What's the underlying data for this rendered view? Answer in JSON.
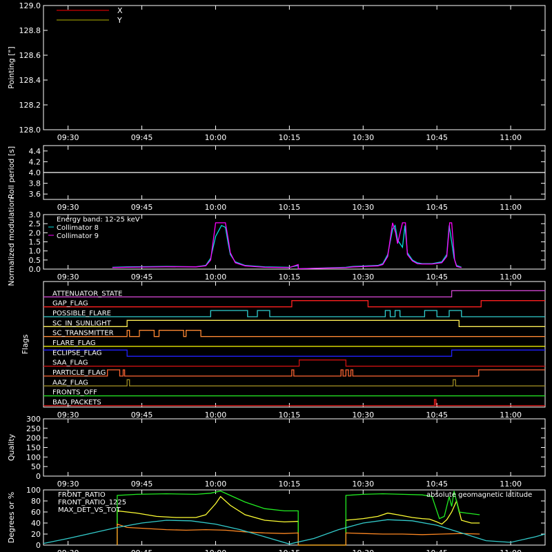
{
  "time_ticks": [
    "09:30",
    "09:45",
    "10:00",
    "10:15",
    "10:30",
    "10:45",
    "11:00"
  ],
  "time_ticks_min": [
    0,
    15,
    30,
    45,
    60,
    75,
    90
  ],
  "time_range_min": [
    -5,
    97
  ],
  "chart_data": [
    {
      "id": "pointing",
      "type": "line",
      "ylabel": "Pointing [\"]",
      "ylim": [
        128.0,
        129.0
      ],
      "yticks": [
        "128.0",
        "128.2",
        "128.4",
        "128.6",
        "128.8",
        "129.0"
      ],
      "legend": [
        {
          "name": "X",
          "color": "#ff0000"
        },
        {
          "name": "Y",
          "color": "#b3b300"
        }
      ],
      "series": []
    },
    {
      "id": "roll",
      "type": "line",
      "ylabel": "Roll period [s]",
      "ylim": [
        3.5,
        4.5
      ],
      "yticks": [
        "3.6",
        "3.8",
        "4.0",
        "4.2",
        "4.4"
      ],
      "series": [
        {
          "color": "#ffffff",
          "x": [
            -5,
            97
          ],
          "y": [
            4.0,
            4.0
          ]
        }
      ]
    },
    {
      "id": "modulation",
      "type": "line",
      "ylabel": "Normalized modulation",
      "ylim": [
        0,
        3.0
      ],
      "yticks": [
        "0.0",
        "0.5",
        "1.0",
        "1.5",
        "2.0",
        "2.5",
        "3.0"
      ],
      "legend_title": "Energy band: 12-25 keV",
      "series": [
        {
          "name": "Collimator 8",
          "color": "#00e0e0",
          "x": [
            9,
            12,
            20,
            26,
            28,
            29,
            30,
            31.2,
            32,
            32.5,
            33,
            34,
            36,
            40,
            45,
            46.8,
            46.8,
            56.5,
            58,
            63,
            64,
            65,
            66,
            66.5,
            67,
            68,
            68.5,
            69,
            70,
            71,
            72,
            74,
            76,
            77,
            77.5,
            78,
            78.5,
            79,
            80
          ],
          "y": [
            0.1,
            0.12,
            0.15,
            0.13,
            0.2,
            0.6,
            1.8,
            2.4,
            2.3,
            1.5,
            0.8,
            0.4,
            0.2,
            0.12,
            0.1,
            0.2,
            0.02,
            0.1,
            0.15,
            0.2,
            0.3,
            0.8,
            2.2,
            2.4,
            1.6,
            1.2,
            2.4,
            0.9,
            0.5,
            0.35,
            0.3,
            0.3,
            0.4,
            0.8,
            2.4,
            1.5,
            0.6,
            0.2,
            0.1
          ]
        },
        {
          "name": "Collimator 9",
          "color": "#ff00ff",
          "x": [
            9,
            12,
            20,
            26,
            28,
            29,
            30,
            31,
            32,
            32.6,
            33,
            34,
            36,
            40,
            45,
            46.8,
            46.8,
            56.5,
            58,
            63,
            64,
            65,
            66,
            66.6,
            67,
            68,
            68.6,
            69,
            70,
            71,
            72,
            74,
            76,
            77,
            77.6,
            78,
            78.6,
            79,
            80
          ],
          "y": [
            0.08,
            0.1,
            0.13,
            0.12,
            0.18,
            0.5,
            2.55,
            2.55,
            2.55,
            1.6,
            0.9,
            0.35,
            0.18,
            0.1,
            0.08,
            0.25,
            0.02,
            0.08,
            0.12,
            0.18,
            0.25,
            0.7,
            2.55,
            2.0,
            1.4,
            2.55,
            2.55,
            0.8,
            0.45,
            0.3,
            0.28,
            0.28,
            0.35,
            0.7,
            2.55,
            2.55,
            0.5,
            0.15,
            0.08
          ]
        }
      ]
    },
    {
      "id": "flags",
      "type": "line",
      "ylabel": "Flags",
      "flags": [
        {
          "name": "ATTENUATOR_STATE",
          "color": "#cc44cc",
          "steps": [
            [
              -5,
              0
            ],
            [
              78,
              1
            ],
            [
              97,
              1
            ]
          ]
        },
        {
          "name": "GAP_FLAG",
          "color": "#ff2020",
          "steps": [
            [
              -5,
              0
            ],
            [
              45.5,
              1
            ],
            [
              61,
              0
            ],
            [
              84,
              1
            ],
            [
              97,
              1
            ]
          ]
        },
        {
          "name": "POSSIBLE_FLARE",
          "color": "#30d0d0",
          "steps": [
            [
              -5,
              0
            ],
            [
              29,
              1
            ],
            [
              36.5,
              0
            ],
            [
              38.5,
              1
            ],
            [
              41,
              0
            ],
            [
              64.5,
              1
            ],
            [
              65.5,
              0
            ],
            [
              66.5,
              1
            ],
            [
              67.5,
              0
            ],
            [
              72.5,
              1
            ],
            [
              75,
              0
            ],
            [
              77.5,
              1
            ],
            [
              80,
              0
            ],
            [
              97,
              0
            ]
          ]
        },
        {
          "name": "SC_IN_SUNLIGHT",
          "color": "#ffee55",
          "steps": [
            [
              -5,
              0
            ],
            [
              12,
              1
            ],
            [
              77.5,
              1
            ],
            [
              79.5,
              0
            ],
            [
              97,
              0
            ]
          ]
        },
        {
          "name": "SC_TRANSMITTER",
          "color": "#ff8833",
          "steps": [
            [
              -5,
              0
            ],
            [
              12,
              1
            ],
            [
              12.5,
              0
            ],
            [
              14.5,
              1
            ],
            [
              17.5,
              0
            ],
            [
              18.5,
              1
            ],
            [
              23.5,
              0
            ],
            [
              24,
              1
            ],
            [
              27,
              0
            ],
            [
              97,
              0
            ]
          ]
        },
        {
          "name": "FLARE_FLAG",
          "color": "#ffff00",
          "steps": [
            [
              -5,
              0
            ],
            [
              97,
              0
            ]
          ]
        },
        {
          "name": "ECLIPSE_FLAG",
          "color": "#2020ff",
          "steps": [
            [
              -5,
              1
            ],
            [
              12,
              0
            ],
            [
              78,
              0
            ],
            [
              78,
              1
            ],
            [
              97,
              1
            ]
          ]
        },
        {
          "name": "SAA_FLAG",
          "color": "#cc1111",
          "steps": [
            [
              -5,
              0
            ],
            [
              47,
              1
            ],
            [
              56.5,
              0
            ],
            [
              97,
              0
            ]
          ]
        },
        {
          "name": "PARTICLE_FLAG",
          "color": "#ff6633",
          "steps": [
            [
              -5,
              0
            ],
            [
              8,
              1
            ],
            [
              10.5,
              0
            ],
            [
              11.2,
              1
            ],
            [
              11.5,
              0
            ],
            [
              45.5,
              1
            ],
            [
              45.9,
              0
            ],
            [
              55.5,
              1
            ],
            [
              55.9,
              0
            ],
            [
              56.5,
              1
            ],
            [
              57,
              0
            ],
            [
              57.5,
              1
            ],
            [
              57.9,
              0
            ],
            [
              83.5,
              1
            ],
            [
              97,
              1
            ]
          ]
        },
        {
          "name": "AAZ_FLAG",
          "color": "#998822",
          "steps": [
            [
              -5,
              0
            ],
            [
              12,
              1
            ],
            [
              12.5,
              0
            ],
            [
              78.3,
              1
            ],
            [
              78.8,
              0
            ],
            [
              97,
              0
            ]
          ]
        },
        {
          "name": "FRONTS_OFF",
          "color": "#22dd22",
          "steps": [
            [
              -5,
              0
            ],
            [
              97,
              0
            ]
          ]
        },
        {
          "name": "BAD_PACKETS",
          "color": "#ff2020",
          "steps": [
            [
              -5,
              0
            ],
            [
              74.5,
              1
            ],
            [
              74.8,
              0
            ],
            [
              97,
              0
            ]
          ]
        }
      ]
    },
    {
      "id": "quality",
      "type": "line",
      "ylabel": "Quality",
      "ylim": [
        0,
        300
      ],
      "yticks": [
        "0",
        "50",
        "100",
        "150",
        "200",
        "250",
        "300"
      ],
      "series": []
    },
    {
      "id": "ratios",
      "type": "line",
      "ylabel": "Degrees or %",
      "ylim": [
        0,
        100
      ],
      "yticks": [
        "0",
        "20",
        "40",
        "60",
        "80",
        "100"
      ],
      "legend": [
        {
          "name": "FRONT_RATIO",
          "color": "#ffff33"
        },
        {
          "name": "FRONT_RATIO_1225",
          "color": "#22ee22"
        },
        {
          "name": "MAX_DET_VS_TOT",
          "color": "#ff8822"
        }
      ],
      "legend_right": {
        "name": "absolute geomagnetic latitude",
        "color": "#33cccc"
      },
      "series": [
        {
          "name": "FRONT_RATIO",
          "color": "#ffff33",
          "x": [
            10,
            10,
            14,
            18,
            22,
            26,
            28,
            30,
            31,
            33,
            36,
            40,
            44,
            46.8,
            46.8,
            56.5,
            56.5,
            60,
            63,
            65,
            67,
            70,
            72,
            73.5,
            75,
            76,
            77,
            78,
            79,
            80,
            82,
            83.7
          ],
          "y": [
            0,
            62,
            58,
            52,
            50,
            50,
            55,
            75,
            88,
            72,
            55,
            45,
            42,
            43,
            0,
            0,
            45,
            48,
            52,
            58,
            55,
            50,
            48,
            47,
            42,
            38,
            46,
            60,
            80,
            45,
            40,
            40
          ]
        },
        {
          "name": "FRONT_RATIO_1225",
          "color": "#22ee22",
          "x": [
            10,
            10,
            14,
            20,
            26,
            29,
            31,
            33,
            36,
            40,
            44,
            46.8,
            46.8,
            56.5,
            56.5,
            60,
            64,
            68,
            72,
            74,
            75.5,
            76.5,
            77.5,
            78,
            78.5,
            79.5,
            81,
            83.7
          ],
          "y": [
            0,
            90,
            92,
            93,
            92,
            94,
            98,
            90,
            78,
            66,
            62,
            62,
            0,
            0,
            90,
            92,
            93,
            92,
            91,
            88,
            48,
            52,
            88,
            70,
            98,
            60,
            58,
            55
          ]
        },
        {
          "name": "MAX_DET_VS_TOT",
          "color": "#ff8822",
          "x": [
            10,
            10,
            12,
            16,
            20,
            24,
            28,
            32,
            36,
            40,
            44,
            46.8,
            46.8,
            56.5,
            56.5,
            60,
            64,
            68,
            72,
            76,
            80,
            83.7
          ],
          "y": [
            0,
            38,
            32,
            30,
            28,
            27,
            28,
            27,
            24,
            22,
            21,
            22,
            0,
            0,
            22,
            21,
            20,
            20,
            19,
            20,
            21,
            20
          ]
        },
        {
          "name": "absolute geomagnetic latitude",
          "color": "#33cccc",
          "x": [
            -5,
            0,
            5,
            10,
            15,
            20,
            25,
            30,
            35,
            40,
            45,
            50,
            55,
            60,
            65,
            70,
            75,
            80,
            85,
            90,
            95,
            97
          ],
          "y": [
            3,
            12,
            22,
            32,
            40,
            45,
            44,
            38,
            28,
            15,
            2,
            12,
            28,
            40,
            46,
            44,
            36,
            22,
            8,
            5,
            15,
            20
          ]
        }
      ]
    }
  ]
}
